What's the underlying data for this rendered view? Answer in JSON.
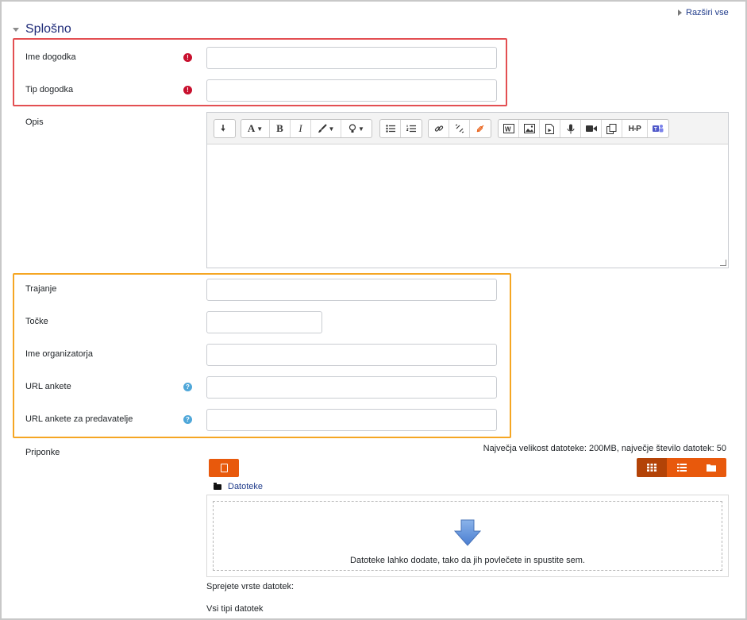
{
  "header": {
    "expand_all": "Razširi vse"
  },
  "section": {
    "title": "Splošno"
  },
  "fields": {
    "event_name": {
      "label": "Ime dogodka",
      "value": ""
    },
    "event_type": {
      "label": "Tip dogodka",
      "value": ""
    },
    "description": {
      "label": "Opis"
    },
    "duration": {
      "label": "Trajanje",
      "value": ""
    },
    "points": {
      "label": "Točke",
      "value": ""
    },
    "organizer": {
      "label": "Ime organizatorja",
      "value": ""
    },
    "survey_url": {
      "label": "URL ankete",
      "value": ""
    },
    "speaker_survey_url": {
      "label": "URL ankete za predavatelje",
      "value": ""
    },
    "attachments": {
      "label": "Priponke"
    }
  },
  "editor": {
    "icons": [
      "collapse-icon",
      "font-icon",
      "bold-icon",
      "italic-icon",
      "brush-icon",
      "lightbulb-icon",
      "bullet-list-icon",
      "numbered-list-icon",
      "link-icon",
      "unlink-icon",
      "no-autolink-icon",
      "word-import-icon",
      "image-icon",
      "media-icon",
      "record-audio-icon",
      "record-video-icon",
      "manage-files-icon",
      "h5p-icon",
      "teams-icon"
    ],
    "labels": {
      "font": "A",
      "bold": "B",
      "italic": "I",
      "h5p": "H-P"
    }
  },
  "filemanager": {
    "limits": "Največja velikost datoteke: 200MB, največje število datotek: 50",
    "path": "Datoteke",
    "drop_text": "Datoteke lahko dodate, tako da jih povlečete in spustite sem.",
    "accepted_label": "Sprejete vrste datotek:",
    "accepted_value": "Vsi tipi datotek"
  },
  "colors": {
    "accent": "#e8590c",
    "required": "#c8102e",
    "help": "#4fa7d9",
    "highlight_red": "#e34f52",
    "highlight_orange": "#f5a623"
  }
}
